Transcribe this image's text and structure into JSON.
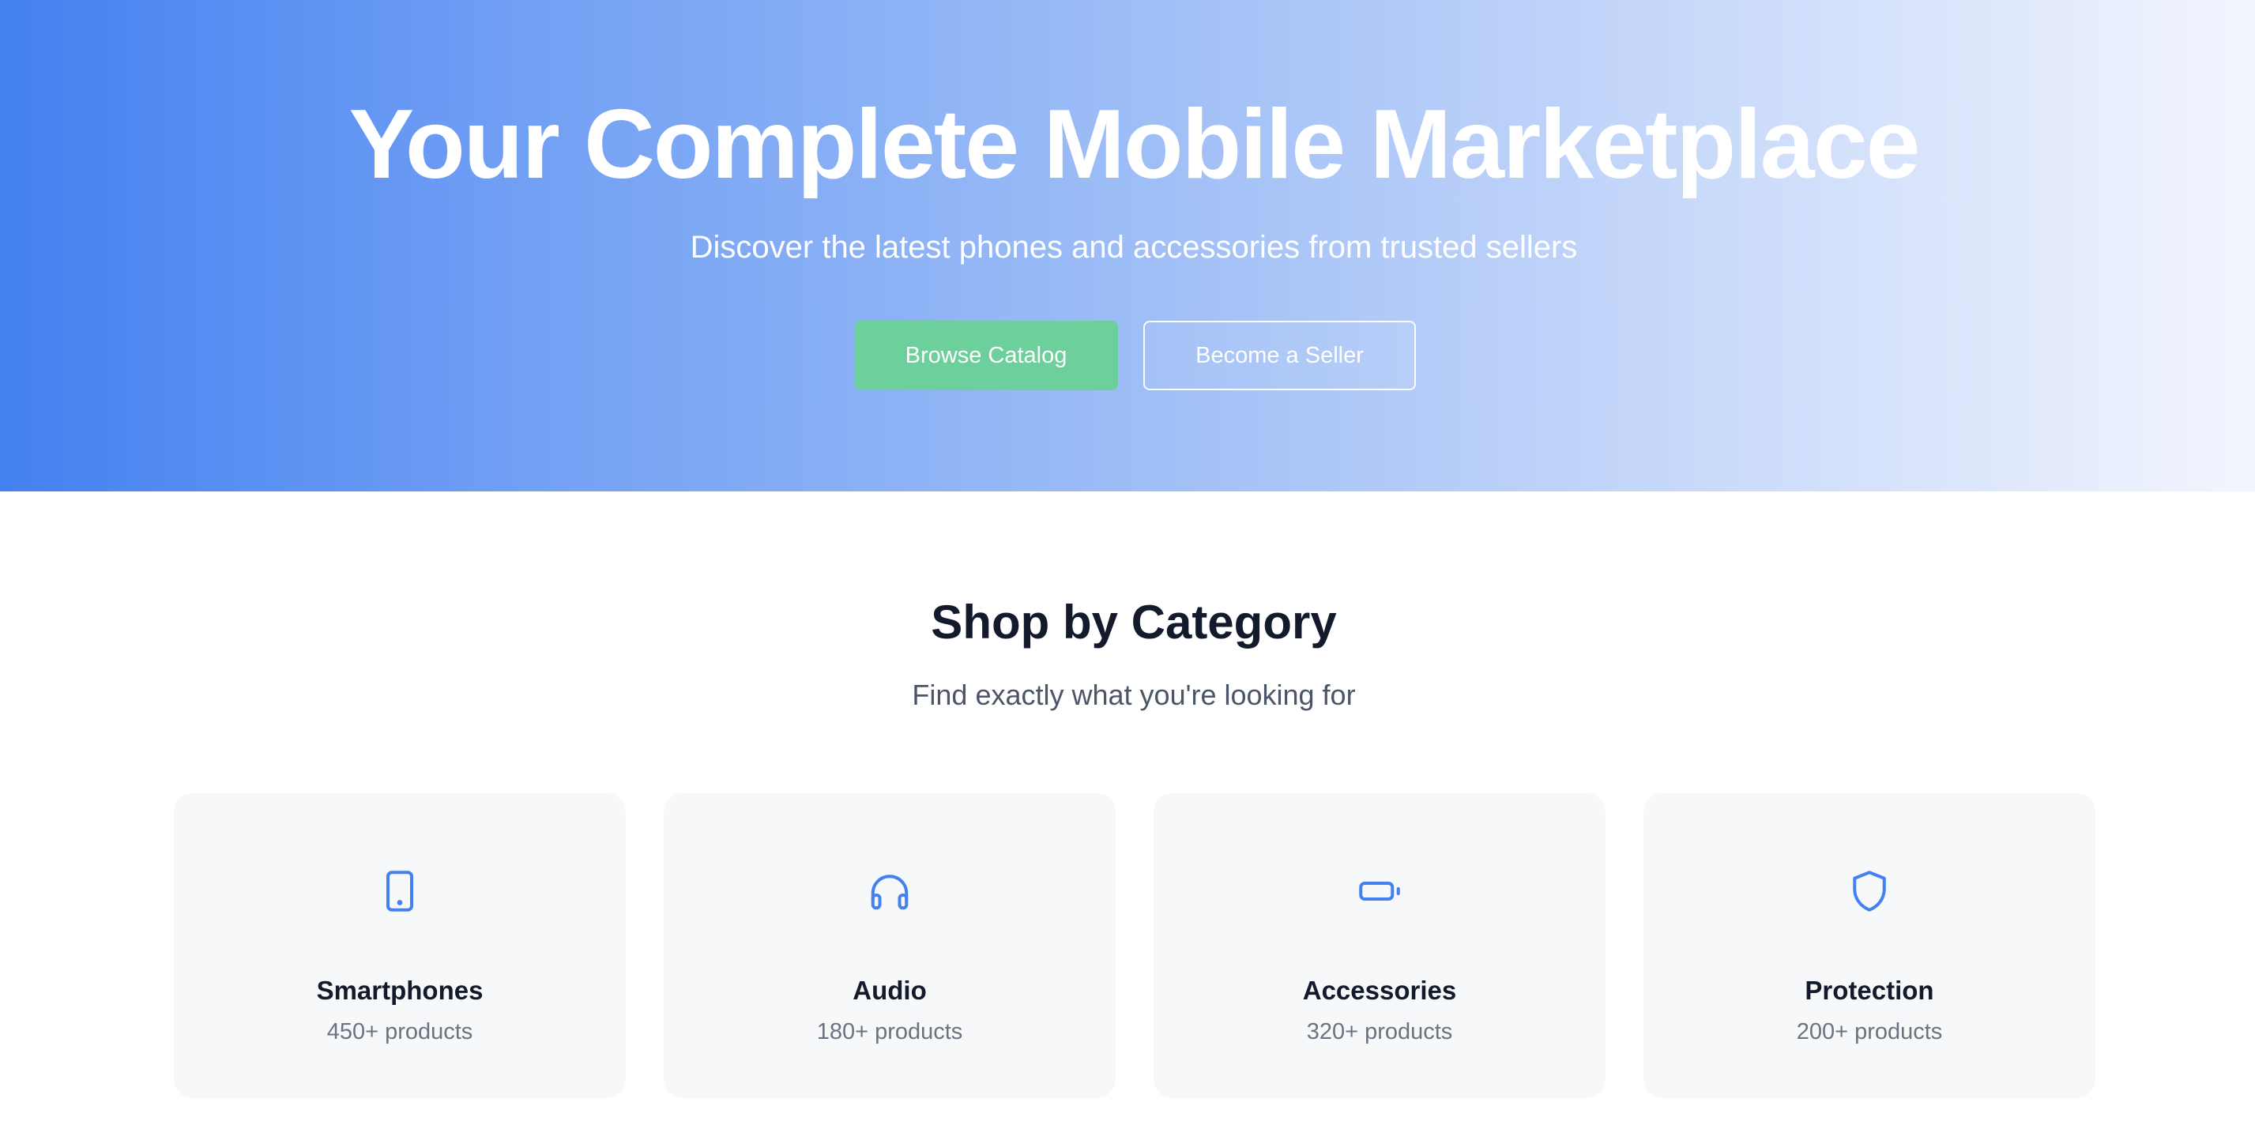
{
  "hero": {
    "title": "Your Complete Mobile Marketplace",
    "subtitle": "Discover the latest phones and accessories from trusted sellers",
    "primary_button": "Browse Catalog",
    "secondary_button": "Become a Seller",
    "gradient_start": "#4381f0",
    "gradient_end": "#f2f5fd",
    "primary_button_color": "#6dcf9b"
  },
  "categories_section": {
    "title": "Shop by Category",
    "subtitle": "Find exactly what you're looking for",
    "icon_color": "#4381f0",
    "cards": [
      {
        "icon": "smartphone-icon",
        "name": "Smartphones",
        "count": "450+ products"
      },
      {
        "icon": "headphones-icon",
        "name": "Audio",
        "count": "180+ products"
      },
      {
        "icon": "battery-icon",
        "name": "Accessories",
        "count": "320+ products"
      },
      {
        "icon": "shield-icon",
        "name": "Protection",
        "count": "200+ products"
      }
    ]
  }
}
